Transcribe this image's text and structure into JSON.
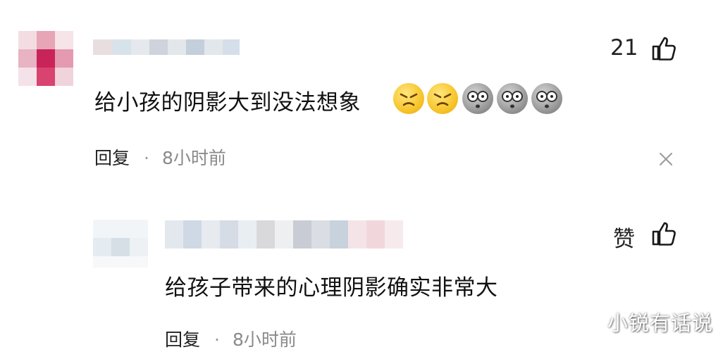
{
  "comments": [
    {
      "text": "给小孩的阴影大到没法想象",
      "like_count": "21",
      "reply_label": "回复",
      "separator": "·",
      "time": "8小时前",
      "emojis": [
        "angry-face",
        "angry-face",
        "shocked-face",
        "shocked-face",
        "shocked-face"
      ]
    },
    {
      "text": "给孩子带来的心理阴影确实非常大",
      "like_label": "赞",
      "reply_label": "回复",
      "separator": "·",
      "time": "8小时前"
    }
  ],
  "watermark": "小锐有话说",
  "colors": {
    "avatar_accent": "#d8436f",
    "time_gray": "#8a8a8a",
    "emoji_yellow": "#f7c52b",
    "emoji_gray": "#9a9a9a"
  }
}
